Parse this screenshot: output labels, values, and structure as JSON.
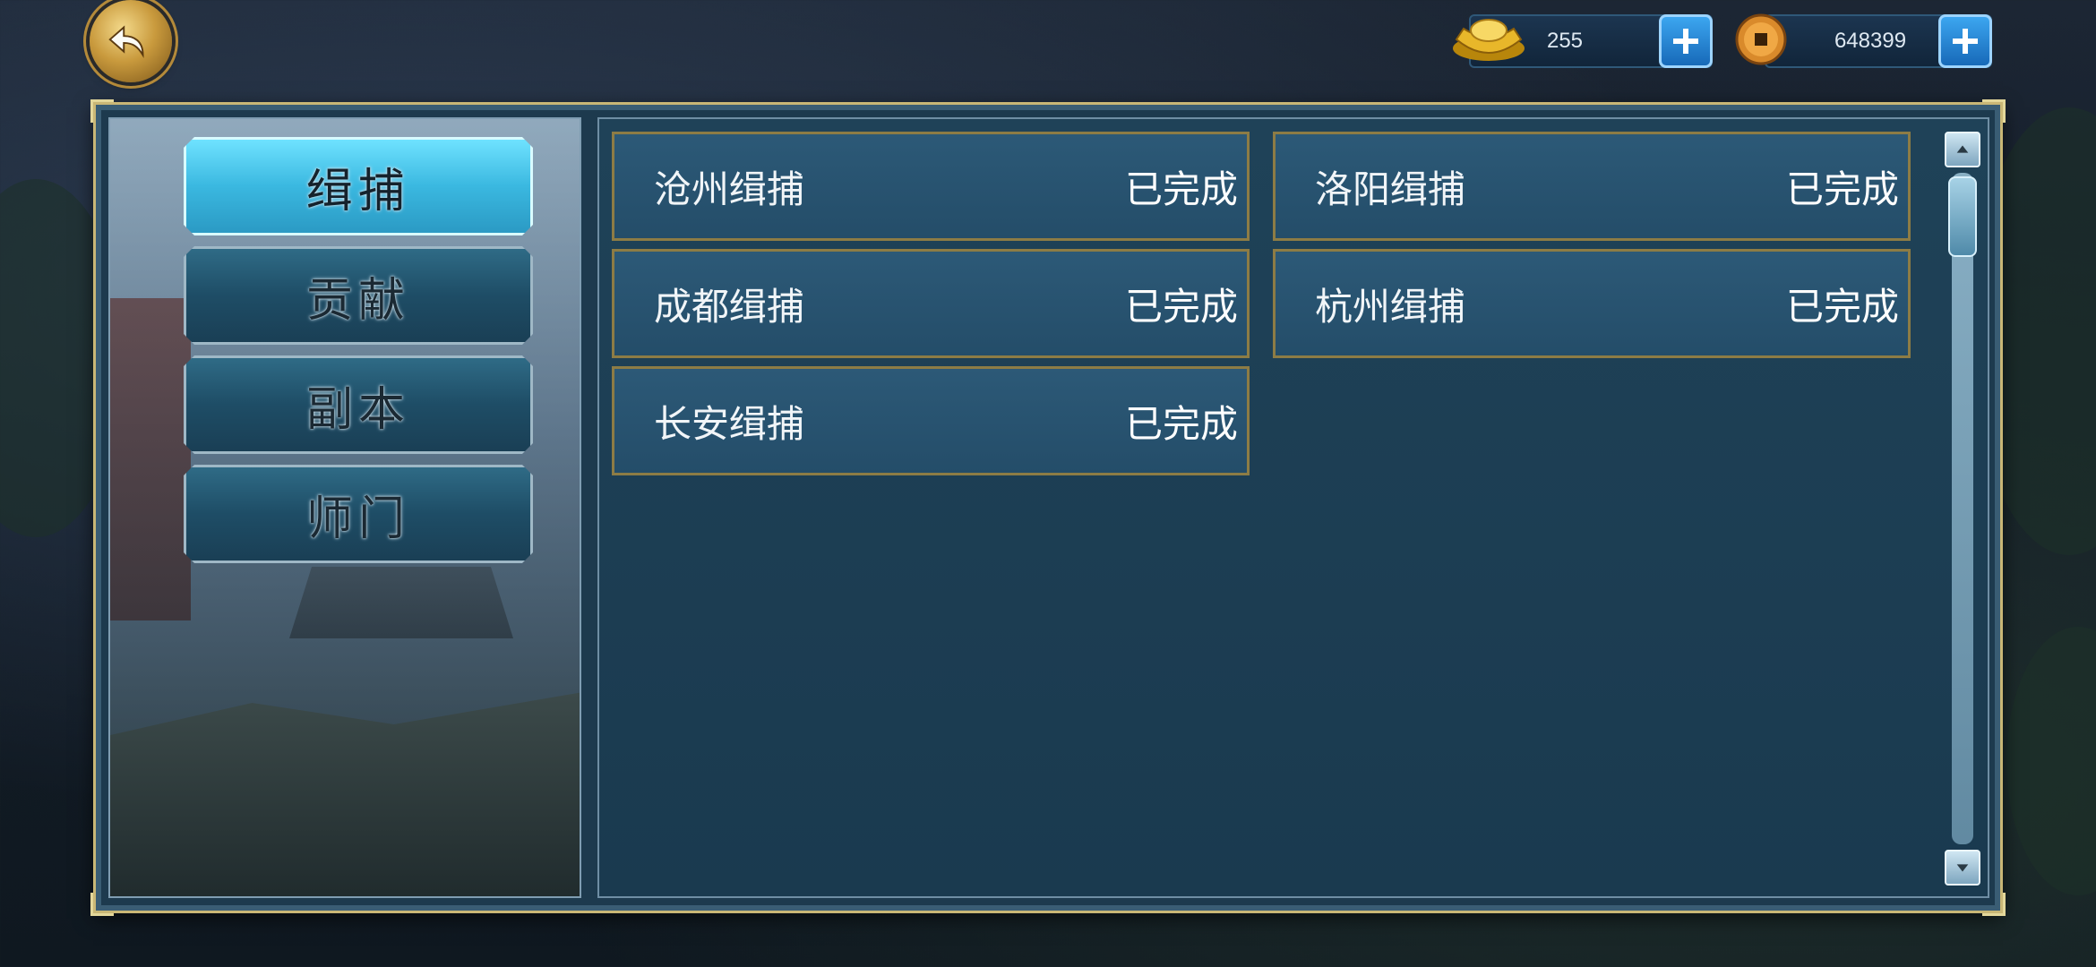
{
  "currency": {
    "gold_ingot": {
      "amount": "255",
      "icon": "gold-ingot-icon"
    },
    "copper_coin": {
      "amount": "648399",
      "icon": "copper-coin-icon"
    }
  },
  "tabs": [
    {
      "label": "缉捕",
      "active": true
    },
    {
      "label": "贡献",
      "active": false
    },
    {
      "label": "副本",
      "active": false
    },
    {
      "label": "师门",
      "active": false
    }
  ],
  "tasks": [
    {
      "name": "沧州缉捕",
      "status": "已完成"
    },
    {
      "name": "洛阳缉捕",
      "status": "已完成"
    },
    {
      "name": "成都缉捕",
      "status": "已完成"
    },
    {
      "name": "杭州缉捕",
      "status": "已完成"
    },
    {
      "name": "长安缉捕",
      "status": "已完成"
    }
  ],
  "colors": {
    "active_tab": "#4fd0f0",
    "card_border": "#8d7c45",
    "panel_border": "#c9b776",
    "plus_button": "#1f86d4"
  }
}
